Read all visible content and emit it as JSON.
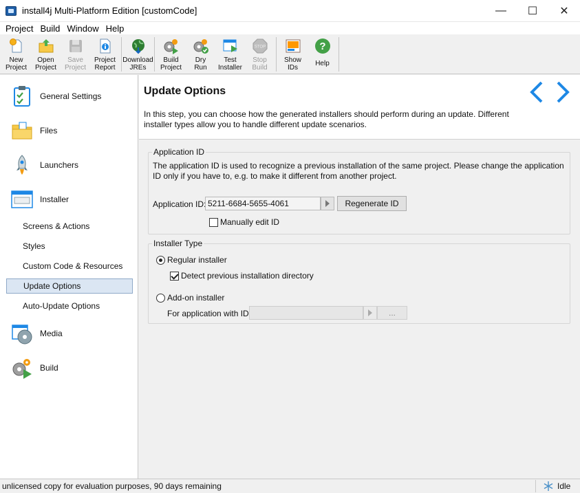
{
  "window": {
    "title": "install4j Multi-Platform Edition [customCode]",
    "minimize": "—",
    "maximize": "☐",
    "close": "✕"
  },
  "menu": [
    "Project",
    "Build",
    "Window",
    "Help"
  ],
  "toolbar": [
    {
      "label": "New\nProject",
      "icon": "new-project-icon",
      "enabled": true
    },
    {
      "label": "Open\nProject",
      "icon": "open-project-icon",
      "enabled": true
    },
    {
      "label": "Save\nProject",
      "icon": "save-project-icon",
      "enabled": false
    },
    {
      "label": "Project\nReport",
      "icon": "project-report-icon",
      "enabled": true
    },
    {
      "label": "Download\nJREs",
      "icon": "download-jres-icon",
      "enabled": true
    },
    {
      "label": "Build\nProject",
      "icon": "build-project-icon",
      "enabled": true
    },
    {
      "label": "Dry\nRun",
      "icon": "dry-run-icon",
      "enabled": true
    },
    {
      "label": "Test\nInstaller",
      "icon": "test-installer-icon",
      "enabled": true
    },
    {
      "label": "Stop\nBuild",
      "icon": "stop-build-icon",
      "enabled": false
    },
    {
      "label": "Show\nIDs",
      "icon": "show-ids-icon",
      "enabled": true
    },
    {
      "label": "Help",
      "icon": "help-icon",
      "enabled": true
    }
  ],
  "sidebar": {
    "sections": [
      {
        "label": "General Settings",
        "icon": "clipboard-check-icon"
      },
      {
        "label": "Files",
        "icon": "folder-files-icon"
      },
      {
        "label": "Launchers",
        "icon": "rocket-icon"
      },
      {
        "label": "Installer",
        "icon": "installer-window-icon"
      },
      {
        "label": "Media",
        "icon": "media-disc-icon"
      },
      {
        "label": "Build",
        "icon": "build-gear-icon"
      }
    ],
    "installer_subitems": [
      {
        "label": "Screens & Actions"
      },
      {
        "label": "Styles"
      },
      {
        "label": "Custom Code & Resources"
      },
      {
        "label": "Update Options",
        "selected": true
      },
      {
        "label": "Auto-Update Options"
      }
    ]
  },
  "content": {
    "title": "Update Options",
    "description": "In this step, you can choose how the generated installers should perform during an update. Different installer types allow you to handle different update scenarios.",
    "application_id_group": {
      "title": "Application ID",
      "description": "The application ID is used to recognize a previous installation of the same project. Please change the application ID only if you have to, e.g. to make it different from another project.",
      "field_label": "Application ID:",
      "field_value": "5211-6684-5655-4061",
      "regenerate_label": "Regenerate ID",
      "manual_edit_label": "Manually edit ID",
      "manual_edit_checked": false
    },
    "installer_type_group": {
      "title": "Installer Type",
      "regular_label": "Regular installer",
      "regular_selected": true,
      "detect_label": "Detect previous installation directory",
      "detect_checked": true,
      "addon_label": "Add-on installer",
      "addon_selected": false,
      "for_app_label": "For application with ID:",
      "for_app_value": "",
      "browse_label": "..."
    }
  },
  "status": {
    "message": "unlicensed copy for evaluation purposes, 90 days remaining",
    "state": "Idle"
  },
  "colors": {
    "accent_blue": "#1e88e5",
    "selection_bg": "#dbe6f3"
  }
}
